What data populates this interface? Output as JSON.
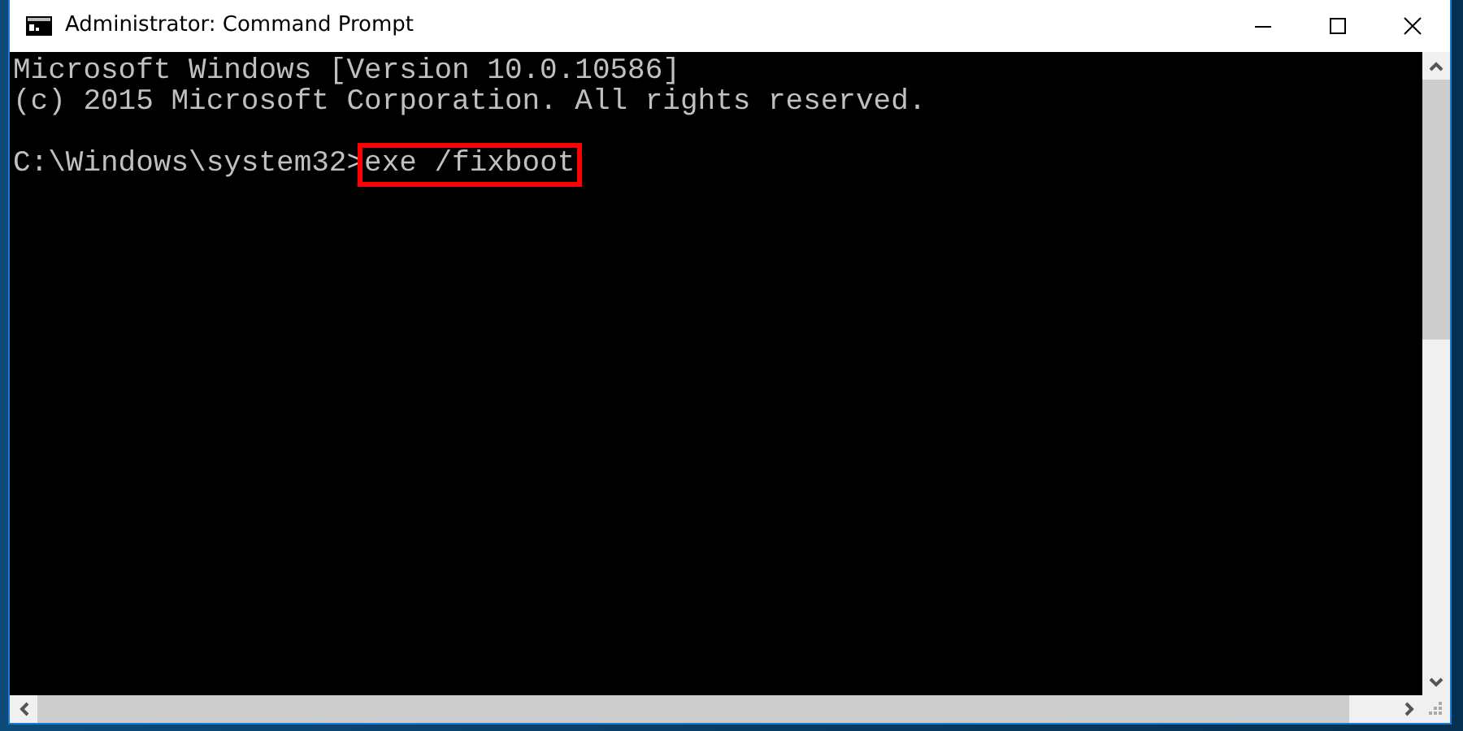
{
  "window": {
    "title": "Administrator: Command Prompt"
  },
  "console": {
    "lines": [
      {
        "text": "Microsoft Windows [Version 10.0.10586]"
      },
      {
        "text": "(c) 2015 Microsoft Corporation. All rights reserved."
      }
    ],
    "prompt": {
      "path": "C:\\Windows\\system32>",
      "command": "exe /fixboot",
      "highlighted": true
    }
  }
}
